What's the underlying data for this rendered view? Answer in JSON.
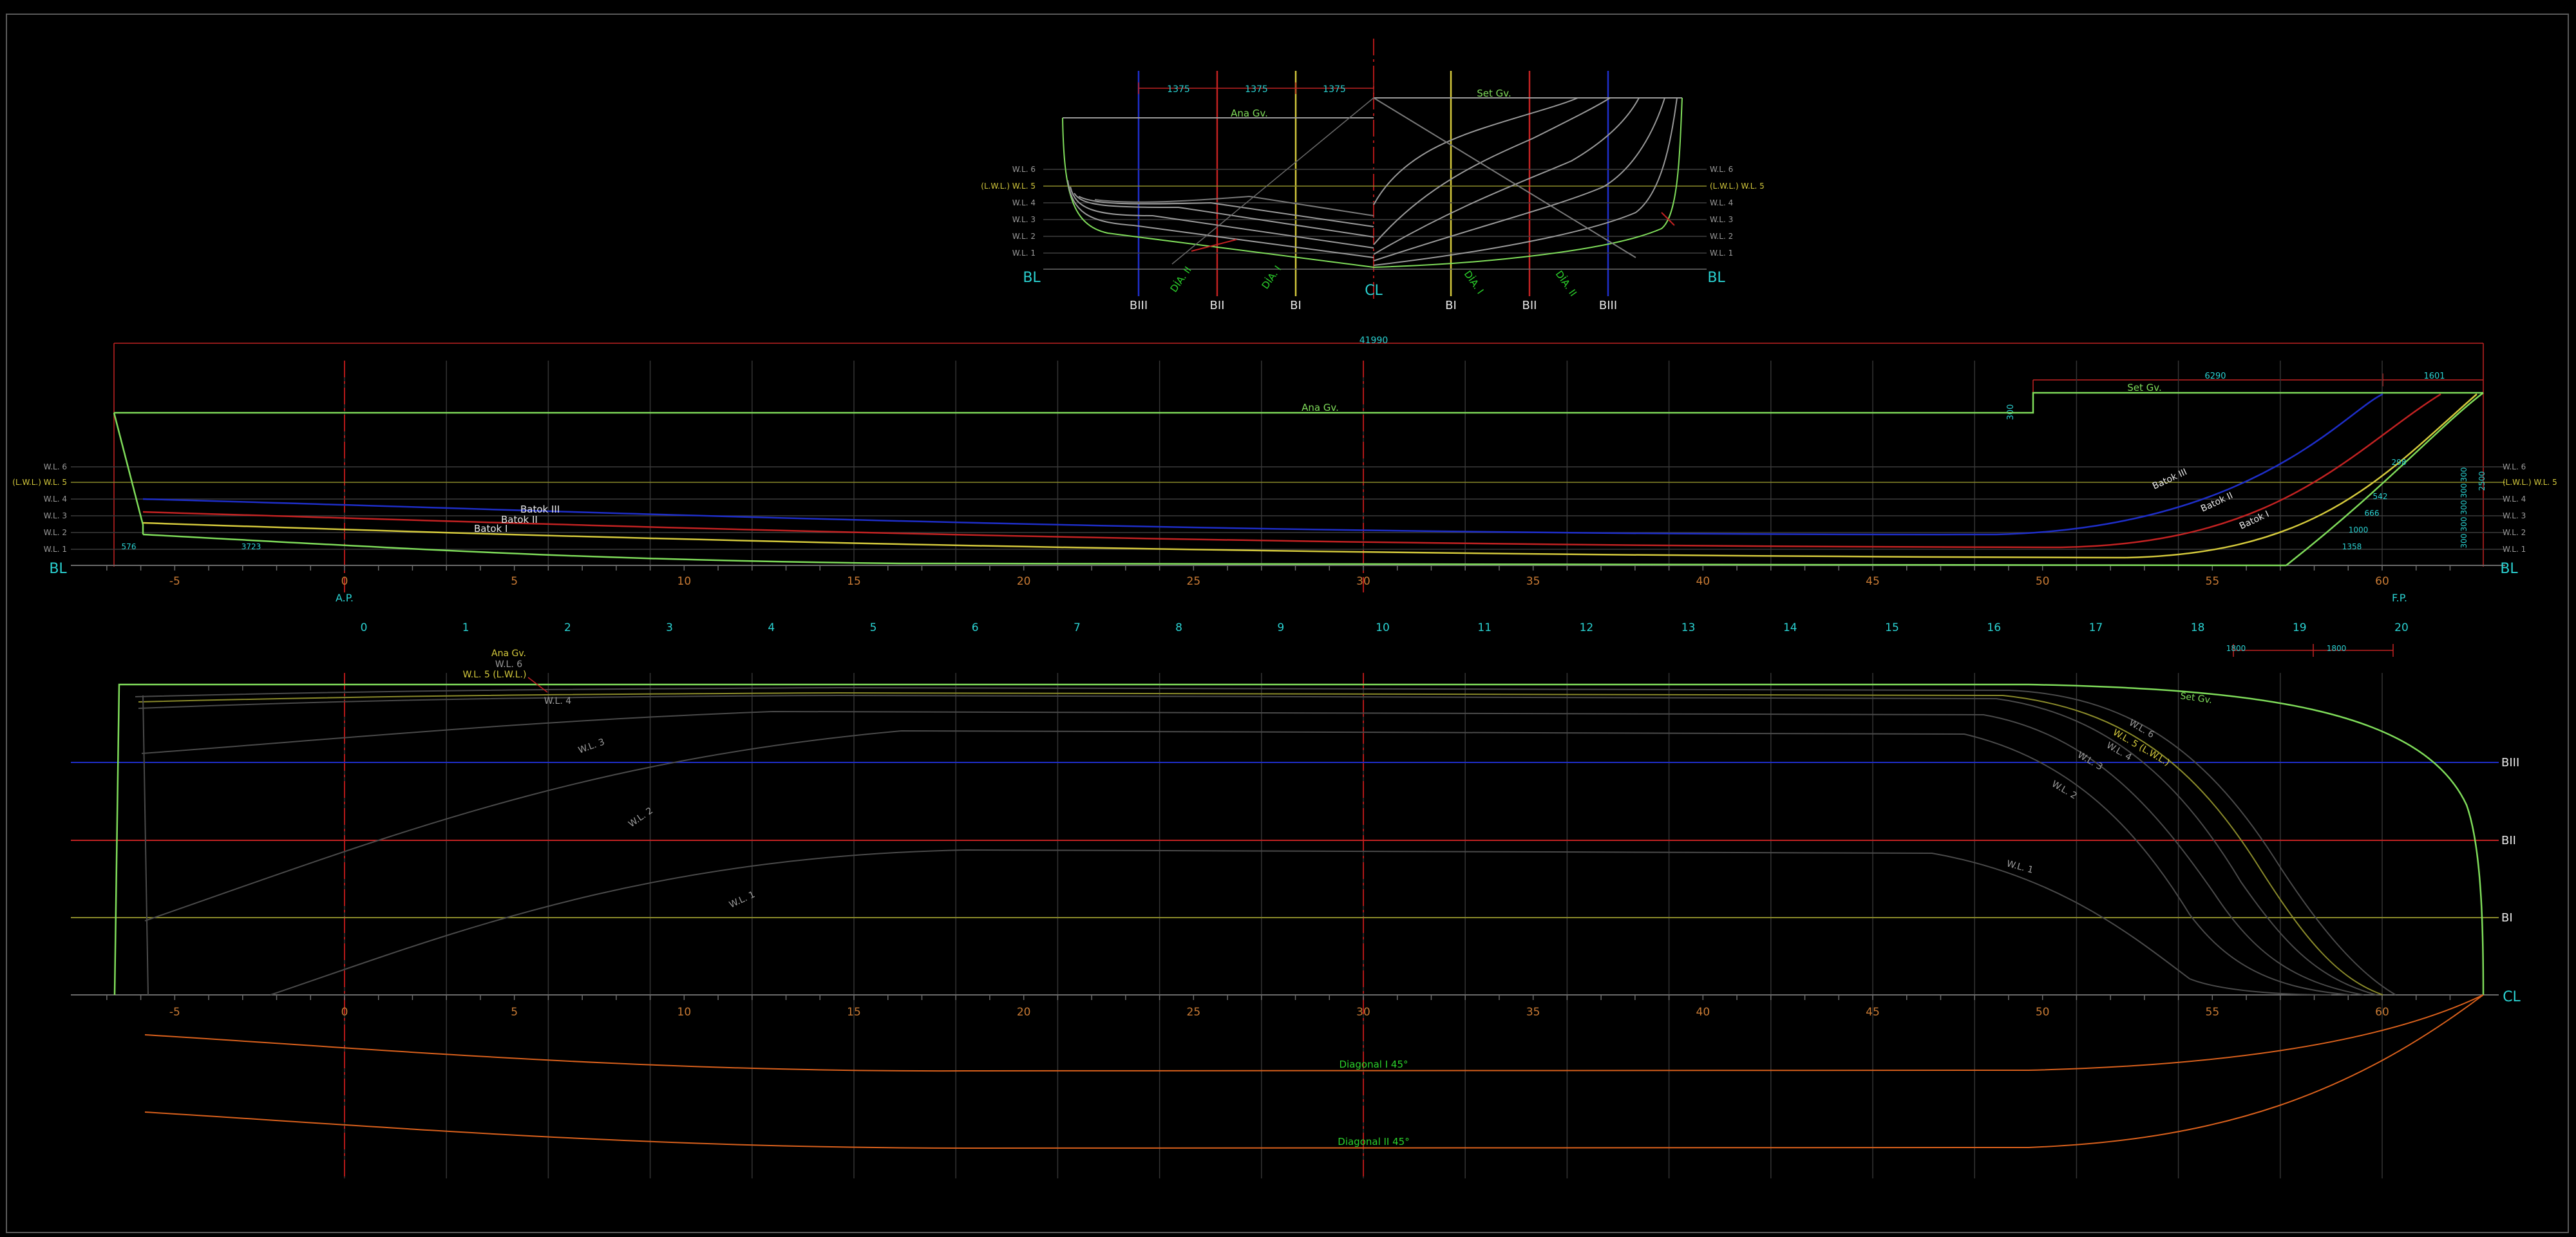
{
  "colors": {
    "background": "#000000",
    "frame": "#5a5a5a",
    "grid": "#3a3a3a",
    "station_ref": "#b01818",
    "green": "#7fdc5a",
    "yellow": "#d4c93c",
    "red": "#c22222",
    "blue": "#1e2ec8",
    "cyan": "#2ad1d1",
    "white": "#e8e8e8",
    "orange": "#d9601c",
    "olive": "#b8b83a",
    "dim": "#7a7a7a",
    "diagonal_green": "#2bd12b",
    "station_number": "#c87a34"
  },
  "body_plan": {
    "dims": [
      "1375",
      "1375",
      "1375"
    ],
    "labels": {
      "ana_gv": "Ana Gv.",
      "set_gv": "Set Gv.",
      "centerline": "CL",
      "baseline_left": "BL",
      "baseline_right": "BL"
    },
    "wl_left": [
      "W.L. 6",
      "(L.W.L.) W.L. 5",
      "W.L. 4",
      "W.L. 3",
      "W.L. 2",
      "W.L. 1"
    ],
    "wl_right": [
      "W.L. 6",
      "(L.W.L.) W.L. 5",
      "W.L. 4",
      "W.L. 3",
      "W.L. 2",
      "W.L. 1"
    ],
    "buttocks": [
      "BIII",
      "BII",
      "BI",
      "BI",
      "BII",
      "BIII"
    ],
    "diagonals": [
      "DİA. II",
      "DİA. I",
      "DİA. I",
      "DİA. II"
    ]
  },
  "profile": {
    "overall_length": "41990",
    "dims_top": [
      "6290",
      "1601"
    ],
    "dim_vertical": "300",
    "labels": {
      "ana_gv": "Ana Gv.",
      "set_gv": "Set Gv.",
      "ap": "A.P.",
      "fp": "F.P.",
      "bl_left": "BL",
      "bl_right": "BL"
    },
    "wl_left": [
      "W.L. 6",
      "(L.W.L.) W.L. 5",
      "W.L. 4",
      "W.L. 3",
      "W.L. 2",
      "W.L. 1"
    ],
    "wl_right": [
      "W.L. 6",
      "(L.W.L.) W.L. 5",
      "W.L. 4",
      "W.L. 3",
      "W.L. 2",
      "W.L. 1"
    ],
    "buttock_labels_aft": [
      "Batok III",
      "Batok II",
      "Batok I"
    ],
    "buttock_labels_fwd": [
      "Batok III",
      "Batok II",
      "Batok I"
    ],
    "aft_dims": [
      "576",
      "3723"
    ],
    "fwd_dims": [
      "298",
      "542",
      "666",
      "1000",
      "1358"
    ],
    "right_dims": [
      "2500",
      "300",
      "300",
      "300",
      "300",
      "300"
    ],
    "station_numbers": [
      "-5",
      "0",
      "5",
      "10",
      "15",
      "20",
      "25",
      "30",
      "35",
      "40",
      "45",
      "50",
      "55",
      "60"
    ],
    "frame_numbers": [
      "0",
      "1",
      "2",
      "3",
      "4",
      "5",
      "6",
      "7",
      "8",
      "9",
      "10",
      "11",
      "12",
      "13",
      "14",
      "15",
      "16",
      "17",
      "18",
      "19",
      "20"
    ]
  },
  "half_breadth": {
    "labels_aft": [
      "Ana Gv.",
      "W.L. 6",
      "W.L. 5 (L.W.L.)",
      "W.L. 4"
    ],
    "wl_labels": [
      "W.L. 3",
      "W.L. 2",
      "W.L. 1"
    ],
    "wl_labels_fwd": [
      "W.L. 6",
      "W.L. 5 (L.W.L.)",
      "W.L. 4",
      "W.L. 3",
      "W.L. 2",
      "W.L. 1"
    ],
    "set_gv": "Set Gv.",
    "buttocks": [
      "BIII",
      "BII",
      "BI"
    ],
    "centerline": "CL",
    "dims": [
      "1800",
      "1800"
    ],
    "station_numbers": [
      "-5",
      "0",
      "5",
      "10",
      "15",
      "20",
      "25",
      "30",
      "35",
      "40",
      "45",
      "50",
      "55",
      "60"
    ]
  },
  "diagonals": {
    "labels": [
      "Diagonal I  45°",
      "Diagonal II  45°"
    ]
  }
}
